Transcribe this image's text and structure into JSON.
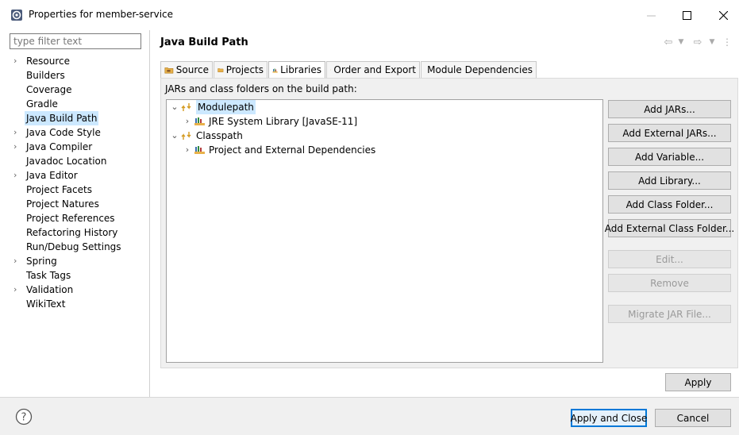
{
  "window": {
    "title": "Properties for member-service"
  },
  "filter": {
    "placeholder": "type filter text"
  },
  "nav": {
    "items": [
      {
        "label": "Resource",
        "expandable": true
      },
      {
        "label": "Builders",
        "expandable": false
      },
      {
        "label": "Coverage",
        "expandable": false
      },
      {
        "label": "Gradle",
        "expandable": false
      },
      {
        "label": "Java Build Path",
        "expandable": false,
        "selected": true
      },
      {
        "label": "Java Code Style",
        "expandable": true
      },
      {
        "label": "Java Compiler",
        "expandable": true
      },
      {
        "label": "Javadoc Location",
        "expandable": false
      },
      {
        "label": "Java Editor",
        "expandable": true
      },
      {
        "label": "Project Facets",
        "expandable": false
      },
      {
        "label": "Project Natures",
        "expandable": false
      },
      {
        "label": "Project References",
        "expandable": false
      },
      {
        "label": "Refactoring History",
        "expandable": false
      },
      {
        "label": "Run/Debug Settings",
        "expandable": false
      },
      {
        "label": "Spring",
        "expandable": true
      },
      {
        "label": "Task Tags",
        "expandable": false
      },
      {
        "label": "Validation",
        "expandable": true
      },
      {
        "label": "WikiText",
        "expandable": false
      }
    ]
  },
  "page": {
    "title": "Java Build Path"
  },
  "tabs": [
    {
      "label": "Source"
    },
    {
      "label": "Projects"
    },
    {
      "label": "Libraries",
      "active": true
    },
    {
      "label": "Order and Export"
    },
    {
      "label": "Module Dependencies"
    }
  ],
  "libraries": {
    "label": "JARs and class folders on the build path:",
    "tree": [
      {
        "label": "Modulepath",
        "expanded": true,
        "level": 0,
        "selected": true
      },
      {
        "label": "JRE System Library [JavaSE-11]",
        "expanded": false,
        "level": 1
      },
      {
        "label": "Classpath",
        "expanded": true,
        "level": 0
      },
      {
        "label": "Project and External Dependencies",
        "expanded": false,
        "level": 1
      }
    ],
    "buttons": {
      "add_jars": "Add JARs...",
      "add_external_jars": "Add External JARs...",
      "add_variable": "Add Variable...",
      "add_library": "Add Library...",
      "add_class_folder": "Add Class Folder...",
      "add_external_class_folder": "Add External Class Folder...",
      "edit": "Edit...",
      "remove": "Remove",
      "migrate_jar": "Migrate JAR File..."
    }
  },
  "footer": {
    "apply": "Apply",
    "apply_close": "Apply and Close",
    "cancel": "Cancel"
  },
  "colors": {
    "selection": "#cce8ff",
    "default_button_border": "#0078d7",
    "folder_icon": "#e8b14a",
    "library_icon": "#3a6fb0"
  }
}
